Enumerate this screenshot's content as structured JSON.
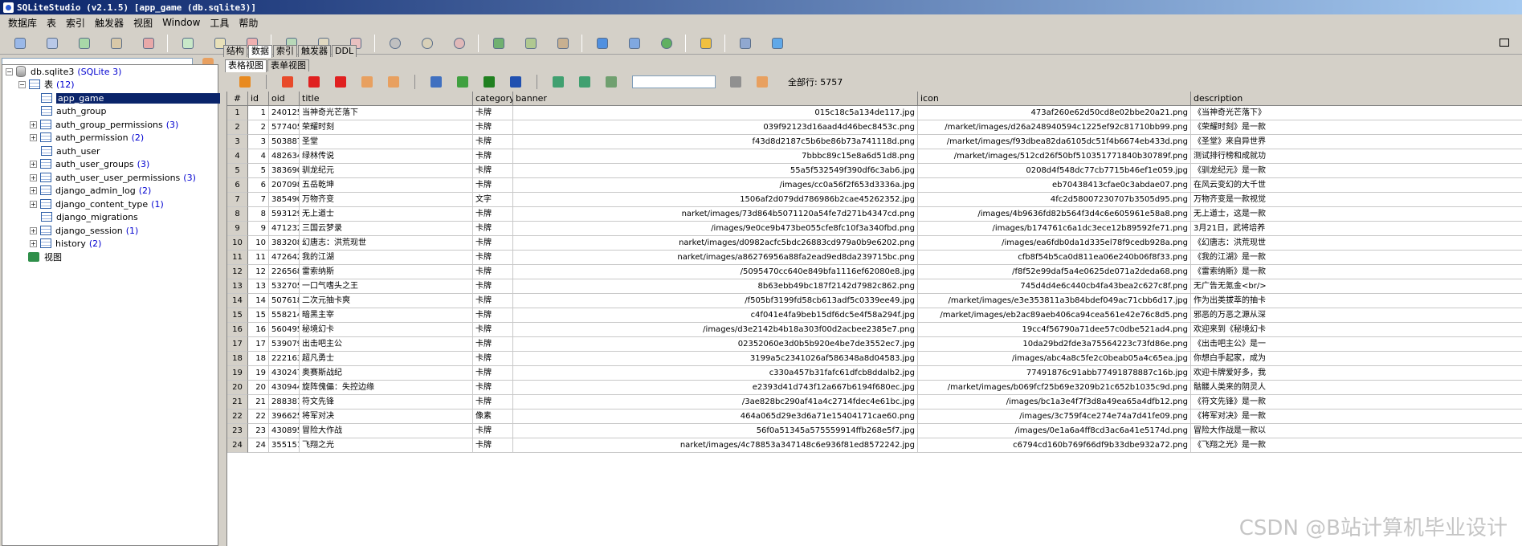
{
  "window": {
    "title": "SQLiteStudio (v2.1.5) [app_game (db.sqlite3)]"
  },
  "menu": [
    "数据库",
    "表",
    "索引",
    "触发器",
    "视图",
    "Window",
    "工具",
    "帮助"
  ],
  "tree": {
    "database": "db.sqlite3",
    "database_type": "(SQLite 3)",
    "tables_label": "表",
    "tables_count": "(12)",
    "tables": [
      {
        "name": "app_game",
        "count": "",
        "selected": true,
        "expandable": false
      },
      {
        "name": "auth_group",
        "count": "",
        "expandable": false
      },
      {
        "name": "auth_group_permissions",
        "count": "(3)",
        "expandable": true
      },
      {
        "name": "auth_permission",
        "count": "(2)",
        "expandable": true
      },
      {
        "name": "auth_user",
        "count": "",
        "expandable": false
      },
      {
        "name": "auth_user_groups",
        "count": "(3)",
        "expandable": true
      },
      {
        "name": "auth_user_user_permissions",
        "count": "(3)",
        "expandable": true
      },
      {
        "name": "django_admin_log",
        "count": "(2)",
        "expandable": true
      },
      {
        "name": "django_content_type",
        "count": "(1)",
        "expandable": true
      },
      {
        "name": "django_migrations",
        "count": "",
        "expandable": false
      },
      {
        "name": "django_session",
        "count": "(1)",
        "expandable": true
      },
      {
        "name": "history",
        "count": "(2)",
        "expandable": true
      }
    ],
    "views_label": "视图"
  },
  "tabs": [
    "结构",
    "数据",
    "索引",
    "触发器",
    "DDL"
  ],
  "subtabs": [
    "表格视图",
    "表单视图"
  ],
  "data_toolbar": {
    "total_rows": "全部行: 5757",
    "filter_placeholder": ""
  },
  "grid": {
    "headers": [
      "#",
      "id",
      "oid",
      "title",
      "category",
      "banner",
      "icon",
      "description"
    ],
    "rows": [
      [
        "1",
        "1",
        "240125",
        "当神奇光芒落下",
        "卡牌",
        "015c18c5a134de117.jpg",
        "473af260e62d50cd8e02bbe20a21.png",
        "《当神奇光芒落下》"
      ],
      [
        "2",
        "2",
        "577405",
        "荣耀时刻",
        "卡牌",
        "039f92123d16aad4d46bec8453c.png",
        "/market/images/d26a248940594c1225ef92c81710bb99.png",
        "《荣耀时刻》是一款"
      ],
      [
        "3",
        "3",
        "503887",
        "圣堂",
        "卡牌",
        "f43d8d2187c5b6be86b73a741118d.png",
        "/market/images/f93dbea82da6105dc51f4b6674eb433d.png",
        "《圣堂》来自异世界"
      ],
      [
        "4",
        "4",
        "482634",
        "绿林传说",
        "卡牌",
        "7bbbc89c15e8a6d51d8.png",
        "/market/images/512cd26f50bf510351771840b30789f.png",
        "测试排行榜和成就功"
      ],
      [
        "5",
        "5",
        "383690",
        "驯龙纪元",
        "卡牌",
        "55a5f532549f390df6c3ab6.jpg",
        "0208d4f548dc77cb7715b46ef1e059.jpg",
        "《驯龙纪元》是一款"
      ],
      [
        "6",
        "6",
        "207098",
        "五岳乾坤",
        "卡牌",
        "/images/cc0a56f2f653d3336a.jpg",
        "eb70438413cfae0c3abdae07.png",
        "在风云变幻的大千世"
      ],
      [
        "7",
        "7",
        "385490",
        "万物齐变",
        "文字",
        "1506af2d079dd786986b2cae45262352.jpg",
        "4fc2d58007230707b3505d95.png",
        "万物齐变是一款视觉"
      ],
      [
        "8",
        "8",
        "593129",
        "无上道士",
        "卡牌",
        "narket/images/73d864b5071120a54fe7d271b4347cd.png",
        "/images/4b9636fd82b564f3d4c6e605961e58a8.png",
        "无上道士，这是一款"
      ],
      [
        "9",
        "9",
        "471232",
        "三国云梦录",
        "卡牌",
        "/images/9e0ce9b473be055cfe8fc10f3a340fbd.png",
        "/images/b174761c6a1dc3ece12b89592fe71.png",
        "3月21日，武将培养"
      ],
      [
        "10",
        "10",
        "383208",
        "幻唐志：洪荒现世",
        "卡牌",
        "narket/images/d0982acfc5bdc26883cd979a0b9e6202.png",
        "/images/ea6fdb0da1d335el78f9cedb928a.png",
        "《幻唐志：洪荒现世"
      ],
      [
        "11",
        "11",
        "472642",
        "我的江湖",
        "卡牌",
        "narket/images/a86276956a88fa2ead9ed8da239715bc.png",
        "cfb8f54b5ca0d811ea06e240b06f8f33.png",
        "《我的江湖》是一款"
      ],
      [
        "12",
        "12",
        "226568",
        "雷索纳斯",
        "卡牌",
        "/5095470cc640e849bfa1116ef62080e8.jpg",
        "/f8f52e99daf5a4e0625de071a2deda68.png",
        "《雷索纳斯》是一款"
      ],
      [
        "13",
        "13",
        "532705",
        "一口气嗜头之王",
        "卡牌",
        "8b63ebb49bc187f2142d7982c862.png",
        "745d4d4e6c440cb4fa43bea2c627c8f.png",
        "无广告无氪金<br/>"
      ],
      [
        "14",
        "14",
        "507618",
        "二次元抽卡爽",
        "卡牌",
        "/f505bf3199fd58cb613adf5c0339ee49.jpg",
        "/market/images/e3e353811a3b84bdef049ac71cbb6d17.jpg",
        "作为出类拔萃的抽卡"
      ],
      [
        "15",
        "15",
        "558214",
        "暗黑主宰",
        "卡牌",
        "c4f041e4fa9beb15df6dc5e4f58a294f.jpg",
        "/market/images/eb2ac89aeb406ca94cea561e42e76c8d5.png",
        "邪恶的万恶之源从深"
      ],
      [
        "16",
        "16",
        "560495",
        "秘境幻卡",
        "卡牌",
        "/images/d3e2142b4b18a303f00d2acbee2385e7.png",
        "19cc4f56790a71dee57c0dbe521ad4.png",
        "欢迎来到《秘境幻卡"
      ],
      [
        "17",
        "17",
        "539079",
        "出击吧主公",
        "卡牌",
        "02352060e3d0b5b920e4be7de3552ec7.jpg",
        "10da29bd2fde3a75564223c73fd86e.png",
        "《出击吧主公》是一"
      ],
      [
        "18",
        "18",
        "222163",
        "超凡勇士",
        "卡牌",
        "3199a5c2341026af586348a8d04583.jpg",
        "/images/abc4a8c5fe2c0beab05a4c65ea.jpg",
        "你想白手起家，成为"
      ],
      [
        "19",
        "19",
        "430247",
        "奥赛斯战纪",
        "卡牌",
        "c330a457b31fafc61dfcb8ddalb2.jpg",
        "77491876c91abb77491878887c16b.jpg",
        "欢迎卡牌爱好多，我"
      ],
      [
        "20",
        "20",
        "430944",
        "旋阵傀儡：失控边缘",
        "卡牌",
        "e2393d41d743f12a667b6194f680ec.jpg",
        "/market/images/b069fcf25b69e3209b21c652b1035c9d.png",
        "骷髅人类来的阴灵人"
      ],
      [
        "21",
        "21",
        "288381",
        "符文先锋",
        "卡牌",
        "/3ae828bc290af41a4c2714fdec4e61bc.jpg",
        "/images/bc1a3e4f7f3d8a49ea65a4dfb12.png",
        "《符文先锋》是一款"
      ],
      [
        "22",
        "22",
        "396625",
        "将军对决",
        "像素",
        "464a065d29e3d6a71e15404171cae60.png",
        "/images/3c759f4ce274e74a7d41fe09.png",
        "《将军对决》是一款"
      ],
      [
        "23",
        "23",
        "430895",
        "冒险大作战",
        "卡牌",
        "56f0a51345a575559914ffb268e5f7.jpg",
        "/images/0e1a6a4ff8cd3ac6a41e5174d.png",
        "冒险大作战是一款以"
      ],
      [
        "24",
        "24",
        "355151",
        "飞翔之光",
        "卡牌",
        "narket/images/4c78853a347148c6e936f81ed8572242.jpg",
        "c6794cd160b769f66df9b33dbe932a72.png",
        "《飞翔之光》是一款"
      ]
    ]
  },
  "watermark": "CSDN @B站计算机毕业设计"
}
